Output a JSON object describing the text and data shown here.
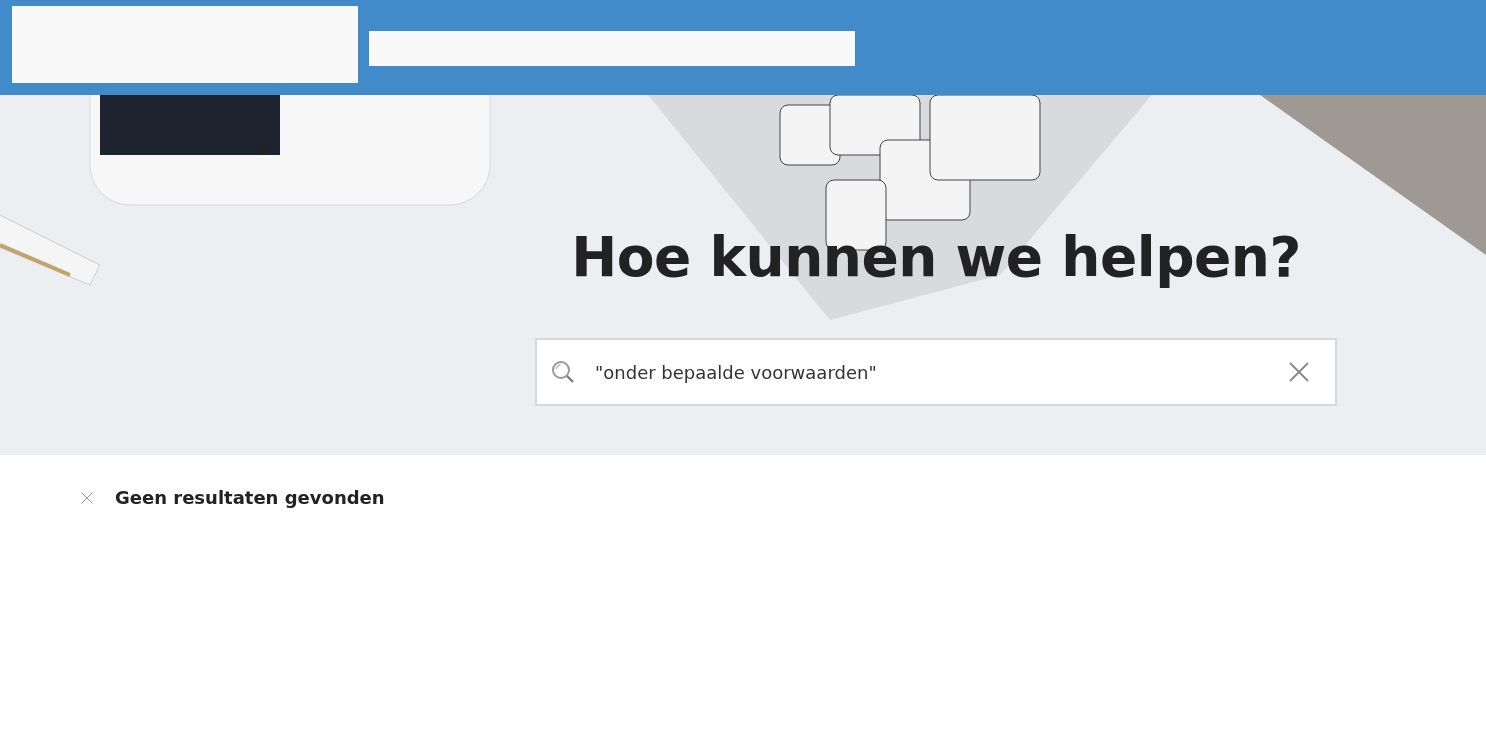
{
  "hero": {
    "kind": "picture",
    "title": "Hoe kunnen we helpen?"
  },
  "search": {
    "value": "\"onder bepaalde voorwaarden\""
  },
  "results": {
    "message": "Geen resultaten gevonden"
  }
}
